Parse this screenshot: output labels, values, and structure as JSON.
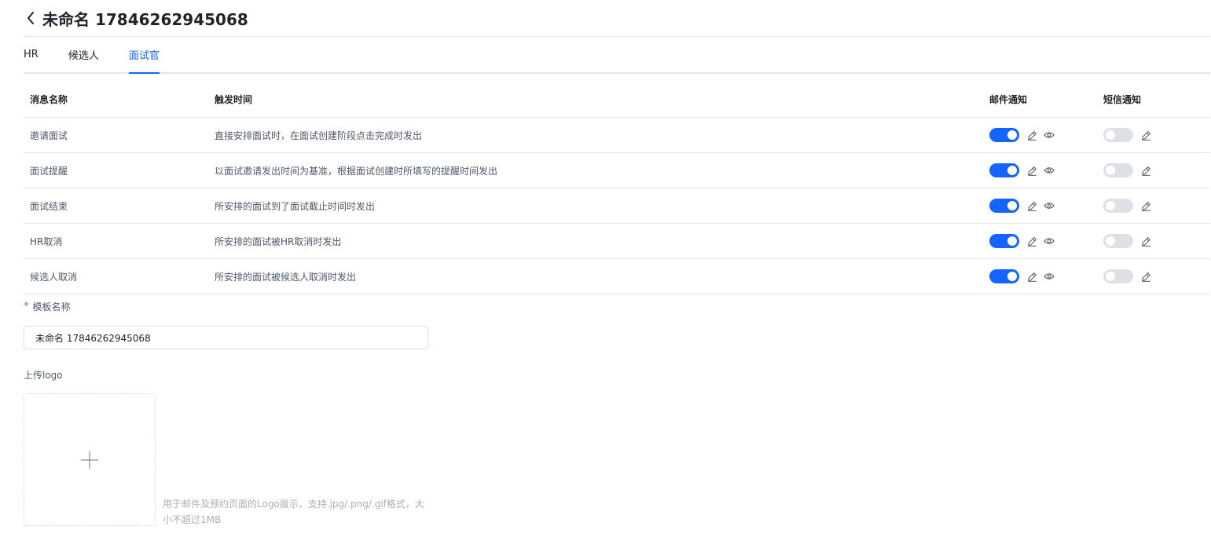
{
  "header": {
    "title": "未命名 17846262945068"
  },
  "tabs": [
    {
      "label": "HR",
      "active": false
    },
    {
      "label": "候选人",
      "active": false
    },
    {
      "label": "面试官",
      "active": true
    }
  ],
  "table": {
    "columns": {
      "name": "消息名称",
      "trigger": "触发时间",
      "email": "邮件通知",
      "sms": "短信通知"
    },
    "rows": [
      {
        "name": "邀请面试",
        "trigger": "直接安排面试时，在面试创建阶段点击完成时发出",
        "email_on": true,
        "sms_on": false
      },
      {
        "name": "面试提醒",
        "trigger": "以面试邀请发出时间为基准，根据面试创建时所填写的提醒时间发出",
        "email_on": true,
        "sms_on": false
      },
      {
        "name": "面试结束",
        "trigger": "所安排的面试到了面试截止时间时发出",
        "email_on": true,
        "sms_on": false
      },
      {
        "name": "HR取消",
        "trigger": "所安排的面试被HR取消时发出",
        "email_on": true,
        "sms_on": false
      },
      {
        "name": "候选人取消",
        "trigger": "所安排的面试被候选人取消时发出",
        "email_on": true,
        "sms_on": false
      }
    ]
  },
  "form": {
    "template_name_label": "模板名称",
    "required_mark": "*",
    "template_name_value": "未命名 17846262945068",
    "upload_label": "上传logo",
    "upload_hint": "用于邮件及预约页面的Logo展示，支持.jpg/.png/.gif格式，大小不超过1MB"
  },
  "colors": {
    "accent": "#1664ff",
    "toggle_off": "#dde0e5",
    "border": "#e4e6eb",
    "required": "#f53f3f"
  },
  "icons": {
    "back": "chevron-left-icon",
    "edit": "pencil-icon",
    "preview": "eye-icon",
    "upload": "plus-icon"
  }
}
